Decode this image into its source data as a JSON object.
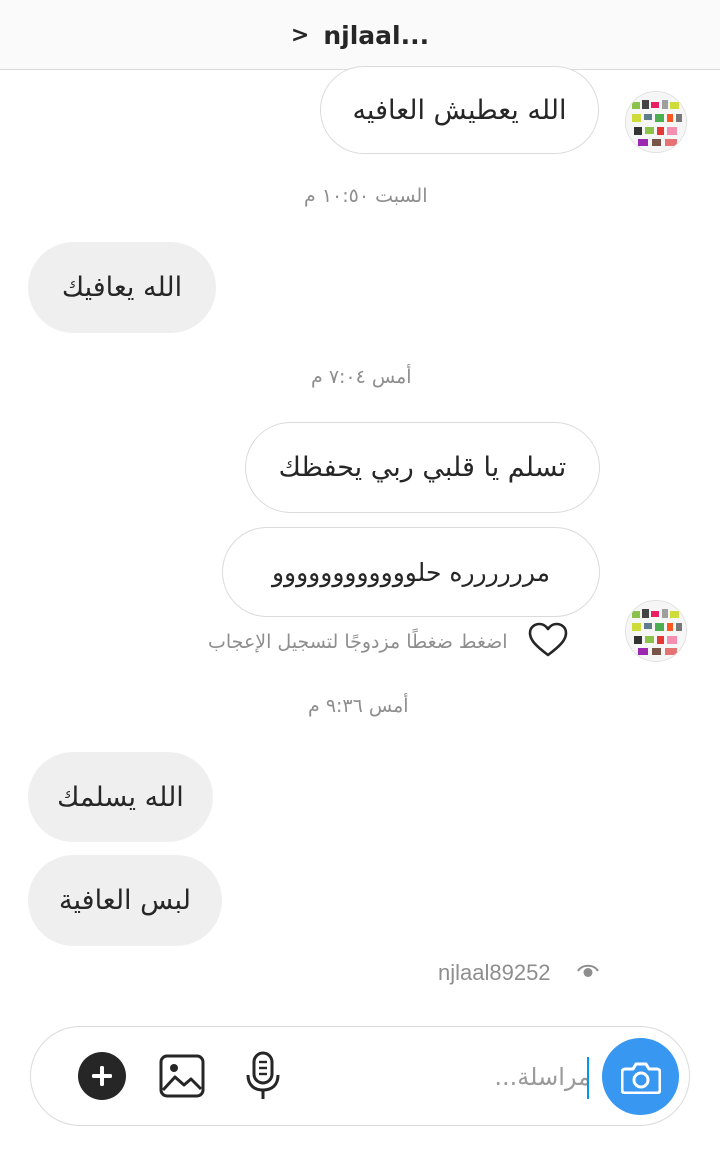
{
  "header": {
    "back_glyph": ">",
    "title": "njlaal..."
  },
  "messages": [
    {
      "text": "الله يعطيش العافيه"
    },
    {
      "text": "الله يعافيك"
    },
    {
      "text": "تسلم يا قلبي ربي يحفظك"
    },
    {
      "text": "مرررررره حلوووووووووووو"
    },
    {
      "text": "الله يسلمك"
    },
    {
      "text": "لبس العافية"
    }
  ],
  "timestamps": [
    "السبت ١٠:٥٠ م",
    "أمس ٧:٠٤ م",
    "أمس ٩:٣٦ م"
  ],
  "like_hint": "اضغط ضغطًا مزدوجًا لتسجيل الإعجاب",
  "seen_by": "njlaal89252",
  "composer": {
    "placeholder": "مراسلة..."
  },
  "icons": [
    "back-chevron-icon",
    "heart-icon",
    "eye-icon",
    "plus-icon",
    "gallery-icon",
    "microphone-icon",
    "camera-icon"
  ],
  "colors": {
    "accent": "#3897f0",
    "incoming_bubble": "#efefef",
    "meta_text": "#8e8e8e",
    "border": "#dbdbdb"
  }
}
